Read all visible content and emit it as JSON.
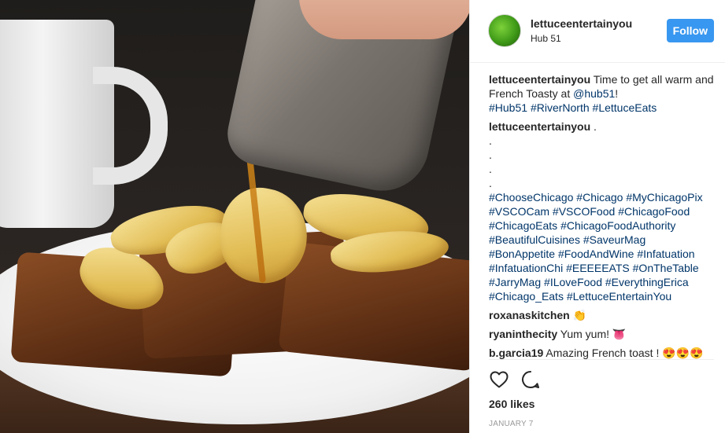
{
  "post": {
    "author": {
      "username": "lettuceentertainyou",
      "location": "Hub 51"
    },
    "follow_label": "Follow",
    "caption": {
      "username": "lettuceentertainyou",
      "text_before": " Time to get all warm and French Toasty at ",
      "mention": "@hub51",
      "text_after": "!",
      "hashtags": [
        "#Hub51",
        "#RiverNorth",
        "#LettuceEats"
      ]
    },
    "comments": [
      {
        "username": "lettuceentertainyou",
        "text": " .",
        "dots": [
          ".",
          ".",
          ".",
          "."
        ],
        "hashtags": [
          "#ChooseChicago",
          "#Chicago",
          "#MyChicagoPix",
          "#VSCOCam",
          "#VSCOFood",
          "#ChicagoFood",
          "#ChicagoEats",
          "#ChicagoFoodAuthority",
          "#BeautifulCuisines",
          "#SaveurMag",
          "#BonAppetite",
          "#FoodAndWine",
          "#Infatuation",
          "#InfatuationChi",
          "#EEEEEATS",
          "#OnTheTable",
          "#JarryMag",
          "#ILoveFood",
          "#EverythingErica",
          "#Chicago_Eats",
          "#LettuceEntertainYou"
        ]
      },
      {
        "username": "roxanaskitchen",
        "text": " 👏"
      },
      {
        "username": "ryaninthecity",
        "text": " Yum yum! 👅"
      },
      {
        "username": "b.garcia19",
        "text": " Amazing French toast ! 😍😍😍"
      }
    ],
    "likes": "260 likes",
    "date": "JANUARY 7",
    "colors": {
      "follow_bg": "#3897f0",
      "tag": "#003569",
      "text": "#262626",
      "muted": "#999999"
    },
    "icons": {
      "like": "heart-outline-icon",
      "comment": "speech-bubble-icon"
    }
  }
}
